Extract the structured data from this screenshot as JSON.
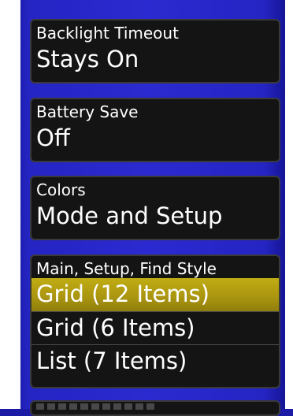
{
  "settings": {
    "backlight_timeout": {
      "label": "Backlight Timeout",
      "value": "Stays On"
    },
    "battery_save": {
      "label": "Battery Save",
      "value": "Off"
    },
    "colors": {
      "label": "Colors",
      "value": "Mode and Setup"
    },
    "menu_style": {
      "label": "Main, Setup, Find Style",
      "options": [
        {
          "label": "Grid (12 Items)",
          "selected": true
        },
        {
          "label": "Grid (6 Items)",
          "selected": false
        },
        {
          "label": "List (7 Items)",
          "selected": false
        }
      ]
    }
  },
  "colors": {
    "background": "#2a2ad0",
    "card": "#141414",
    "highlight": "#b8a411",
    "text": "#ffffff"
  }
}
